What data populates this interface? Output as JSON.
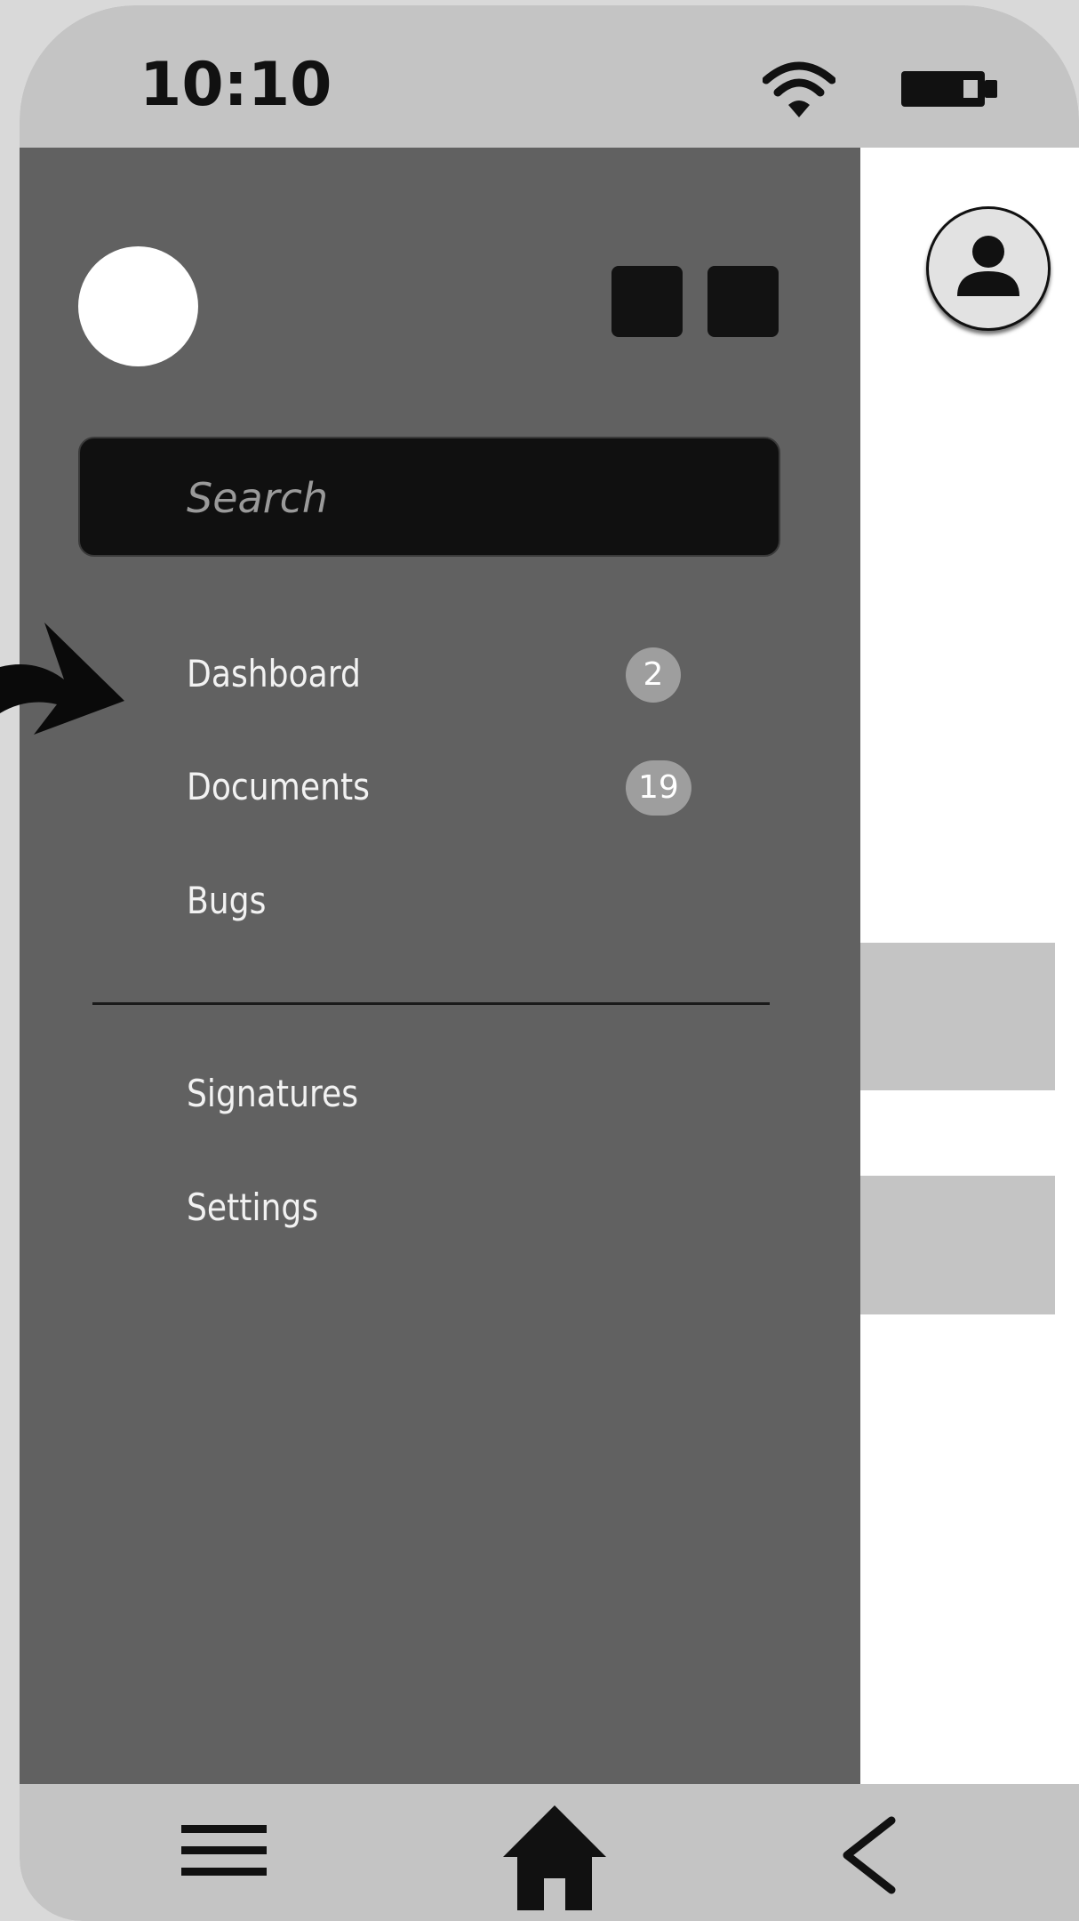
{
  "status_bar": {
    "time": "10:10",
    "icons": [
      "wifi-icon",
      "battery-icon"
    ]
  },
  "drawer": {
    "search": {
      "placeholder": "Search"
    },
    "menu": [
      {
        "label": "Dashboard",
        "badge": "2"
      },
      {
        "label": "Documents",
        "badge": "19"
      },
      {
        "label": "Bugs"
      }
    ],
    "secondary_menu": [
      {
        "label": "Signatures"
      },
      {
        "label": "Settings"
      }
    ]
  },
  "bottom_nav": {
    "icons": [
      "menu-icon",
      "home-icon",
      "back-chevron-icon"
    ]
  },
  "colors": {
    "drawer_bg": "#616161",
    "bars": "#c4c4c4",
    "search_bg": "#101010",
    "badge_bg": "#9e9e9e"
  }
}
